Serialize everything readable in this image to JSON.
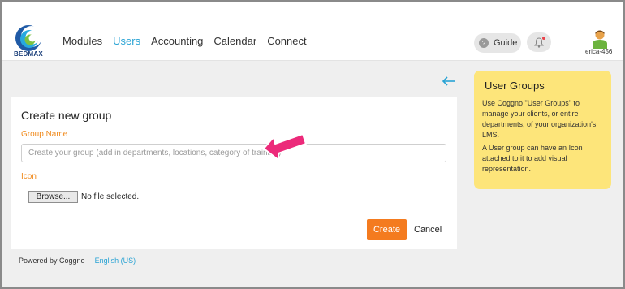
{
  "header": {
    "logo_text": "BEDMAX",
    "nav": [
      {
        "label": "Modules",
        "active": false
      },
      {
        "label": "Users",
        "active": true
      },
      {
        "label": "Accounting",
        "active": false
      },
      {
        "label": "Calendar",
        "active": false
      },
      {
        "label": "Connect",
        "active": false
      }
    ],
    "guide_label": "Guide",
    "username": "erica-456"
  },
  "form": {
    "title": "Create new group",
    "group_name_label": "Group Name",
    "group_name_placeholder": "Create your group (add in departments, locations, category of training)",
    "group_name_value": "",
    "icon_label": "Icon",
    "browse_label": "Browse...",
    "file_status": "No file selected.",
    "create_label": "Create",
    "cancel_label": "Cancel"
  },
  "footer": {
    "powered_by": "Powered by Coggno ·",
    "language": "English (US)"
  },
  "help": {
    "title": "User Groups",
    "paragraph1": "Use Coggno \"User Groups\" to manage your clients, or entire departments, of your organization's LMS.",
    "paragraph2": "A User group can have an Icon attached to it to add visual representation."
  },
  "colors": {
    "accent_blue": "#29a3d4",
    "orange": "#f47b1f",
    "label_orange": "#f08a1c",
    "help_bg": "#fde57a",
    "annotation_pink": "#ec2a7a"
  },
  "icons": [
    "logo",
    "question-icon",
    "bell-icon",
    "user-avatar-icon",
    "back-arrow-icon",
    "annotation-arrow"
  ]
}
